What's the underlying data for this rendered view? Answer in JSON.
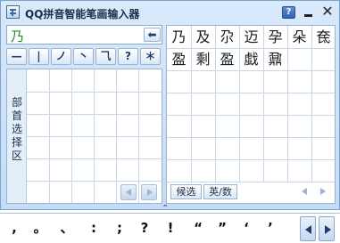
{
  "window": {
    "title": "QQ拼音智能笔画输入器"
  },
  "titlebar": {
    "help": "?",
    "close": "✕"
  },
  "input": {
    "value": "乃",
    "back_icon": "arrow-left-icon",
    "back_glyph": "⬅"
  },
  "strokes": [
    "—",
    "|",
    "ノ",
    "丶",
    "⺄",
    "?",
    "＊"
  ],
  "radical_panel": {
    "label": "部首选择区"
  },
  "candidates": {
    "row1": [
      "乃",
      "及",
      "尕",
      "迈",
      "孕",
      "朵",
      "奃"
    ],
    "row2": [
      "盈",
      "剩",
      "盈",
      "戱",
      "鼐"
    ]
  },
  "tabs": {
    "candidates": "候选",
    "en_num": "英/数"
  },
  "punctuation": [
    ",",
    "。",
    "、",
    ":",
    ";",
    "?",
    "!",
    "“",
    "”",
    "‘",
    "’"
  ],
  "colors": {
    "title_bg": "#c4dcf4",
    "accent": "#2f62ad",
    "grid": "#c7d6ea"
  }
}
